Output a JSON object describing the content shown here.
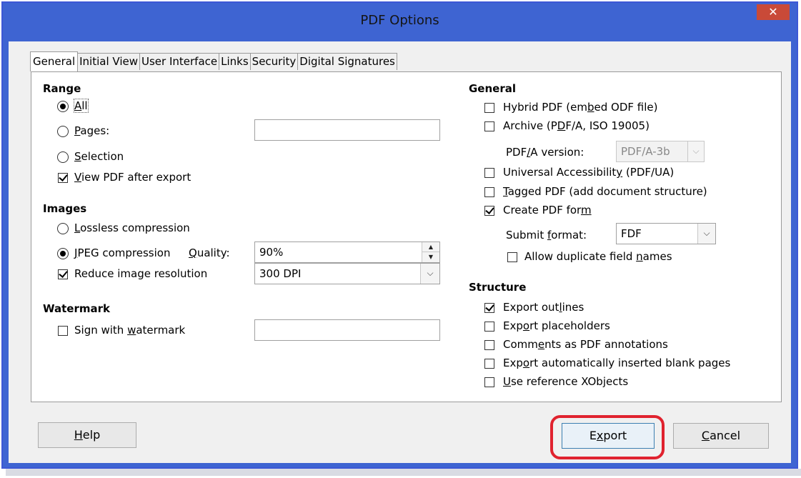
{
  "window": {
    "title": "PDF Options",
    "close_glyph": "✕"
  },
  "tabs": [
    "General",
    "Initial View",
    "User Interface",
    "Links",
    "Security",
    "Digital Signatures"
  ],
  "range": {
    "heading": "Range",
    "all": {
      "pre": "",
      "key": "A",
      "post": "ll",
      "selected": true
    },
    "pages": {
      "pre": "",
      "key": "P",
      "post": "ages:",
      "selected": false,
      "value": ""
    },
    "selection": {
      "pre": "",
      "key": "S",
      "post": "election",
      "selected": false
    },
    "view_after_export": {
      "pre": "",
      "key": "V",
      "post": "iew PDF after export",
      "checked": true
    }
  },
  "images": {
    "heading": "Images",
    "lossless": {
      "pre": "",
      "key": "L",
      "post": "ossless compression",
      "selected": false
    },
    "jpeg": {
      "pre": "",
      "key": "J",
      "post": "PEG compression",
      "selected": true
    },
    "quality_label": {
      "pre": "",
      "key": "Q",
      "post": "uality:"
    },
    "quality_value": "90%",
    "reduce_resolution": {
      "label": "Reduce image resolution",
      "checked": true
    },
    "resolution_value": "300 DPI"
  },
  "watermark": {
    "heading": "Watermark",
    "sign": {
      "pre": "Sign with ",
      "key": "w",
      "post": "atermark",
      "checked": false
    },
    "value": ""
  },
  "general": {
    "heading": "General",
    "hybrid": {
      "pre": "Hybrid PDF (em",
      "key": "b",
      "post": "ed ODF file)",
      "checked": false
    },
    "archive": {
      "pre": "Archive (P",
      "key": "D",
      "post": "F/A, ISO 19005)",
      "checked": false
    },
    "pdfa_label": {
      "pre": "PDF",
      "key": "/",
      "post": "A version:"
    },
    "pdfa_value": "PDF/A-3b",
    "universal": {
      "pre": "Universal Accessibilit",
      "key": "y",
      "post": " (PDF/UA)",
      "checked": false
    },
    "tagged": {
      "pre": "",
      "key": "T",
      "post": "agged PDF (add document structure)",
      "checked": false
    },
    "create_form": {
      "pre": "Create PDF for",
      "key": "m",
      "post": "",
      "checked": true
    },
    "submit_label": {
      "pre": "Submit ",
      "key": "f",
      "post": "ormat:"
    },
    "submit_value": "FDF",
    "allow_duplicate": {
      "pre": "Allow duplicate field ",
      "key": "n",
      "post": "ames",
      "checked": false
    }
  },
  "structure": {
    "heading": "Structure",
    "outlines": {
      "pre": "Export out",
      "key": "l",
      "post": "ines",
      "checked": true
    },
    "placeholders": {
      "pre": "Exp",
      "key": "o",
      "post": "rt placeholders",
      "checked": false
    },
    "comments": {
      "pre": "Comm",
      "key": "e",
      "post": "nts as PDF annotations",
      "checked": false
    },
    "blank_pages": {
      "pre": "Exp",
      "key": "o",
      "post": "rt automatically inserted blank pages",
      "checked": false
    },
    "xobjects": {
      "pre": "",
      "key": "U",
      "post": "se reference XObjects",
      "checked": false
    }
  },
  "buttons": {
    "help": {
      "pre": "",
      "key": "H",
      "post": "elp"
    },
    "export": {
      "pre": "E",
      "key": "x",
      "post": "port"
    },
    "cancel": {
      "pre": "",
      "key": "C",
      "post": "ancel"
    }
  },
  "colors": {
    "frame": "#3e64d2",
    "close": "#c94a38",
    "highlight": "#e0222e"
  }
}
